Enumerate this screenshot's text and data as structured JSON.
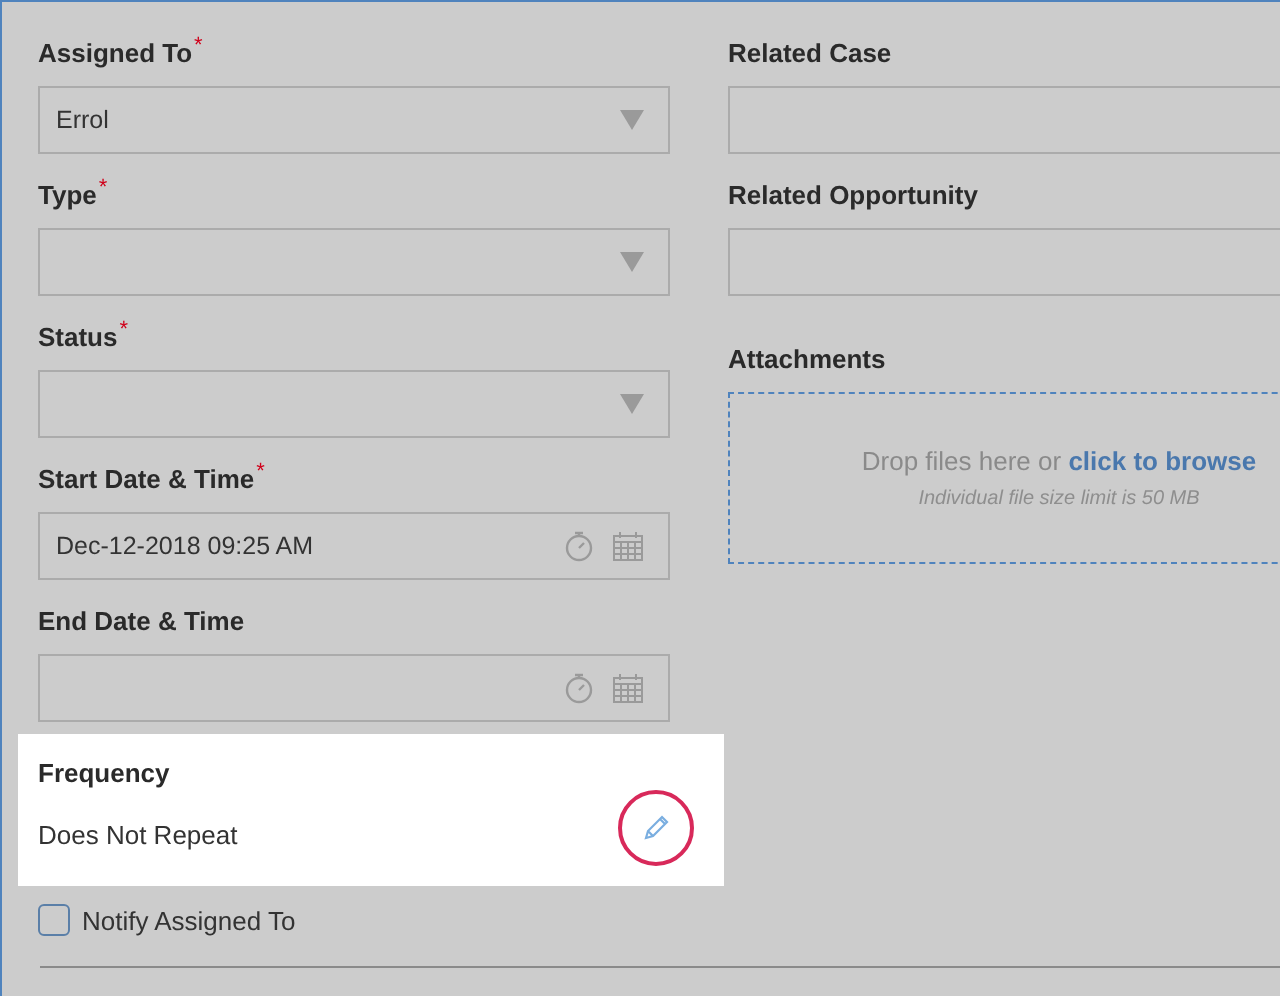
{
  "left_fields": [
    {
      "label": "Assigned To",
      "required_mark": "*",
      "kind": "select",
      "value": "Errol"
    },
    {
      "label": "Type",
      "required_mark": "*",
      "kind": "select"
    },
    {
      "label": "Status",
      "required_mark": "*",
      "kind": "select"
    },
    {
      "label": "Start Date & Time",
      "required_mark": "*",
      "kind": "datetime",
      "value": "Dec-12-2018 09:25 AM"
    },
    {
      "label": "End Date & Time",
      "kind": "datetime"
    }
  ],
  "right_fields": [
    {
      "label": "Related Case",
      "kind": "text"
    },
    {
      "label": "Related Opportunity",
      "kind": "text"
    }
  ],
  "attachments": {
    "label": "Attachments",
    "drop_text": "Drop files here or",
    "browse_link": "click to browse",
    "limit_note": "Individual file size limit is 50 MB"
  },
  "frequency": {
    "label": "Frequency",
    "value": "Does Not Repeat"
  },
  "notify": {
    "label": "Notify Assigned To",
    "checked": false
  }
}
